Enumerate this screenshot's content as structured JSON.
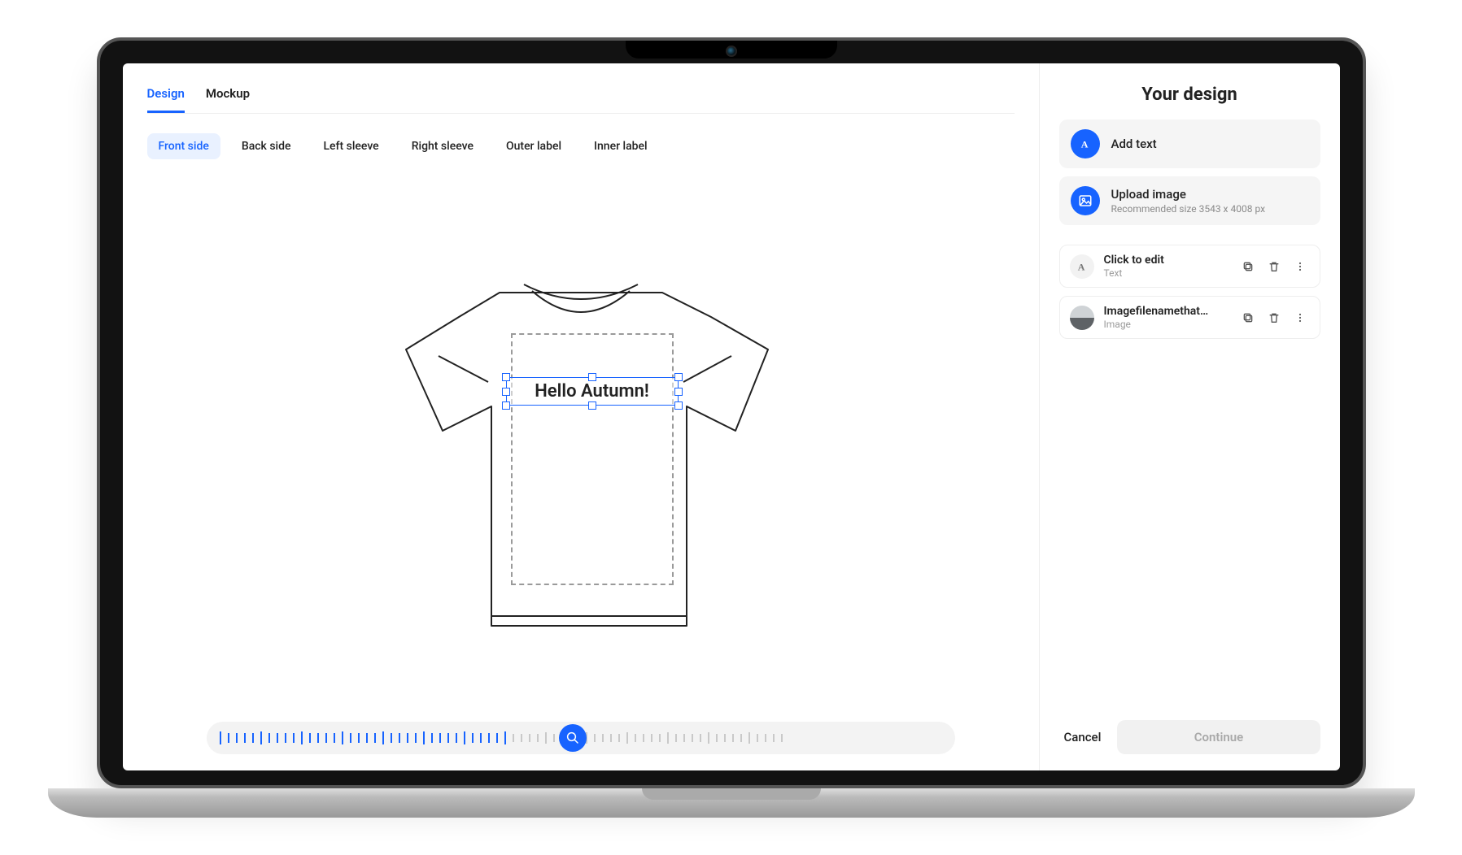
{
  "top_tabs": {
    "design": "Design",
    "mockup": "Mockup",
    "active": "design"
  },
  "side_tabs": {
    "items": [
      "Front side",
      "Back side",
      "Left sleeve",
      "Right sleeve",
      "Outer label",
      "Inner label"
    ],
    "active_index": 0
  },
  "canvas": {
    "text_element": {
      "content": "Hello Autumn!"
    }
  },
  "zoom": {
    "value_percent": 50
  },
  "panel": {
    "title": "Your design",
    "add_text": {
      "label": "Add text"
    },
    "upload": {
      "label": "Upload image",
      "hint": "Recommended size 3543 x 4008 px"
    },
    "layers": [
      {
        "title": "Click to edit",
        "subtitle": "Text",
        "kind": "text"
      },
      {
        "title": "Imagefilenamethat…",
        "subtitle": "Image",
        "kind": "image"
      }
    ]
  },
  "footer": {
    "cancel": "Cancel",
    "continue": "Continue"
  }
}
